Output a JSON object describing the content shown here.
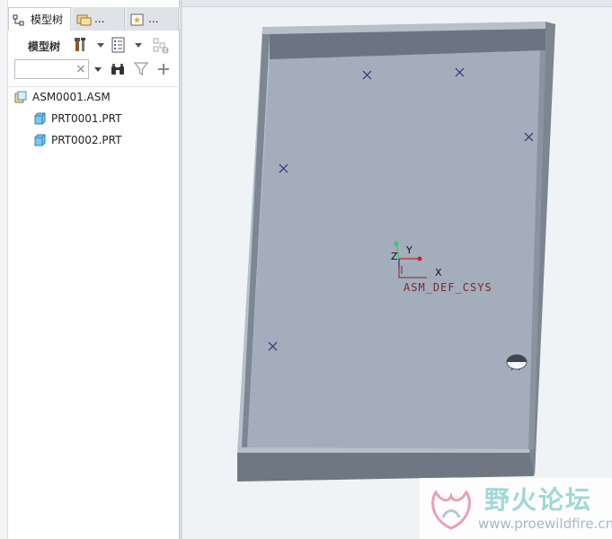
{
  "left_panel": {
    "tabs": [
      {
        "label": "模型树"
      },
      {
        "label": "..."
      },
      {
        "label": "..."
      }
    ],
    "toolbar": {
      "title": "模型树"
    },
    "search": {
      "value": "",
      "clear_glyph": "×"
    },
    "tree": [
      {
        "label": "ASM0001.ASM",
        "icon": "assembly-icon",
        "level": 0
      },
      {
        "label": "PRT0001.PRT",
        "icon": "part-icon",
        "level": 1
      },
      {
        "label": "PRT0002.PRT",
        "icon": "part-icon",
        "level": 1
      }
    ]
  },
  "viewport": {
    "csys_name": "ASM_DEF_CSYS",
    "axes": {
      "x": "X",
      "y": "Y",
      "z": "Z"
    },
    "colors": {
      "plate_top": "#a3adbc",
      "plate_side_dark": "#6f7782",
      "plate_rim": "#b6bfcc",
      "point_marker": "#2c2a6e",
      "csys_red": "#cc2222",
      "csys_green": "#33cc66"
    }
  },
  "watermark": {
    "title": "野火论坛",
    "url": "www.proewildfire.cn"
  }
}
